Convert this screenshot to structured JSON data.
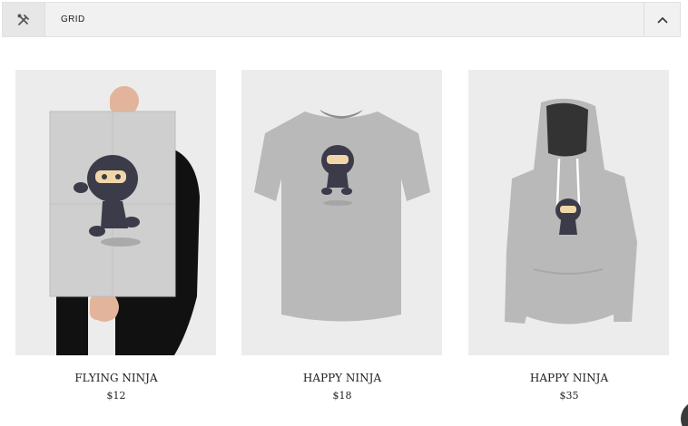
{
  "block": {
    "title": "GRID",
    "tool_icon": "tools-icon",
    "toggle_icon": "chevron-up-icon"
  },
  "products": [
    {
      "name": "FLYING NINJA",
      "price": "$12",
      "image": "poster-image"
    },
    {
      "name": "HAPPY NINJA",
      "price": "$18",
      "image": "tshirt-image"
    },
    {
      "name": "HAPPY NINJA",
      "price": "$35",
      "image": "hoodie-image"
    }
  ],
  "colors": {
    "header_bg": "#f1f1f1",
    "image_bg": "#ececec",
    "text": "#1e1e1e",
    "garment": "#b9b9b9",
    "ninja": "#3b3b4a"
  }
}
